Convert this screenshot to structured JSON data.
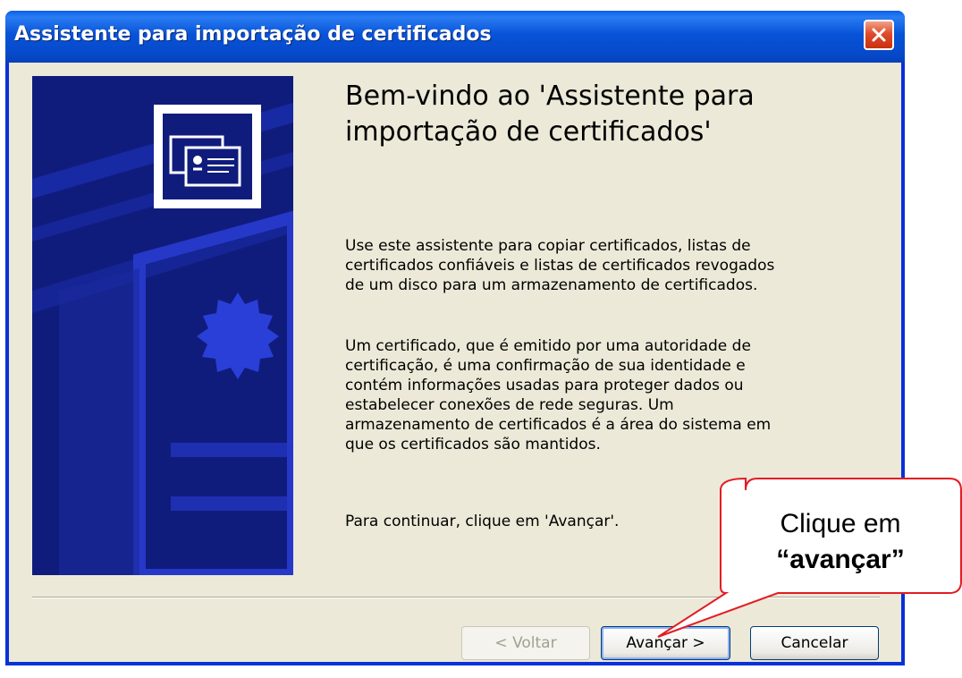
{
  "window": {
    "title": "Assistente para importação de certificados"
  },
  "content": {
    "welcome_title": "Bem-vindo ao 'Assistente para importação de certificados'",
    "paragraph1": "Use este assistente para copiar certificados, listas de\ncertificados confiáveis e listas de certificados revogados\nde um disco para um armazenamento de certificados.",
    "paragraph2": "Um certificado, que é emitido por uma autoridade de\ncertificação, é uma confirmação de sua identidade e\ncontém informações usadas para proteger dados ou\nestabelecer conexões de rede seguras. Um\narmazenamento de certificados é a área do sistema em\nque os certificados são mantidos.",
    "paragraph3": "Para continuar, clique em 'Avançar'."
  },
  "buttons": {
    "back_label": "< Voltar",
    "back_enabled": false,
    "next_label": "Avançar >",
    "cancel_label": "Cancelar"
  },
  "callout": {
    "line1": "Clique em",
    "line2": "“avançar”"
  },
  "icons": {
    "close": "close-icon",
    "certificate": "certificate-icon",
    "seal": "seal-icon"
  },
  "colors": {
    "titlebar": "#0853d8",
    "close_button": "#e04c2b",
    "dialog_background": "#ece9d8",
    "banner": "#101c7c",
    "callout_border": "#e31c23"
  }
}
